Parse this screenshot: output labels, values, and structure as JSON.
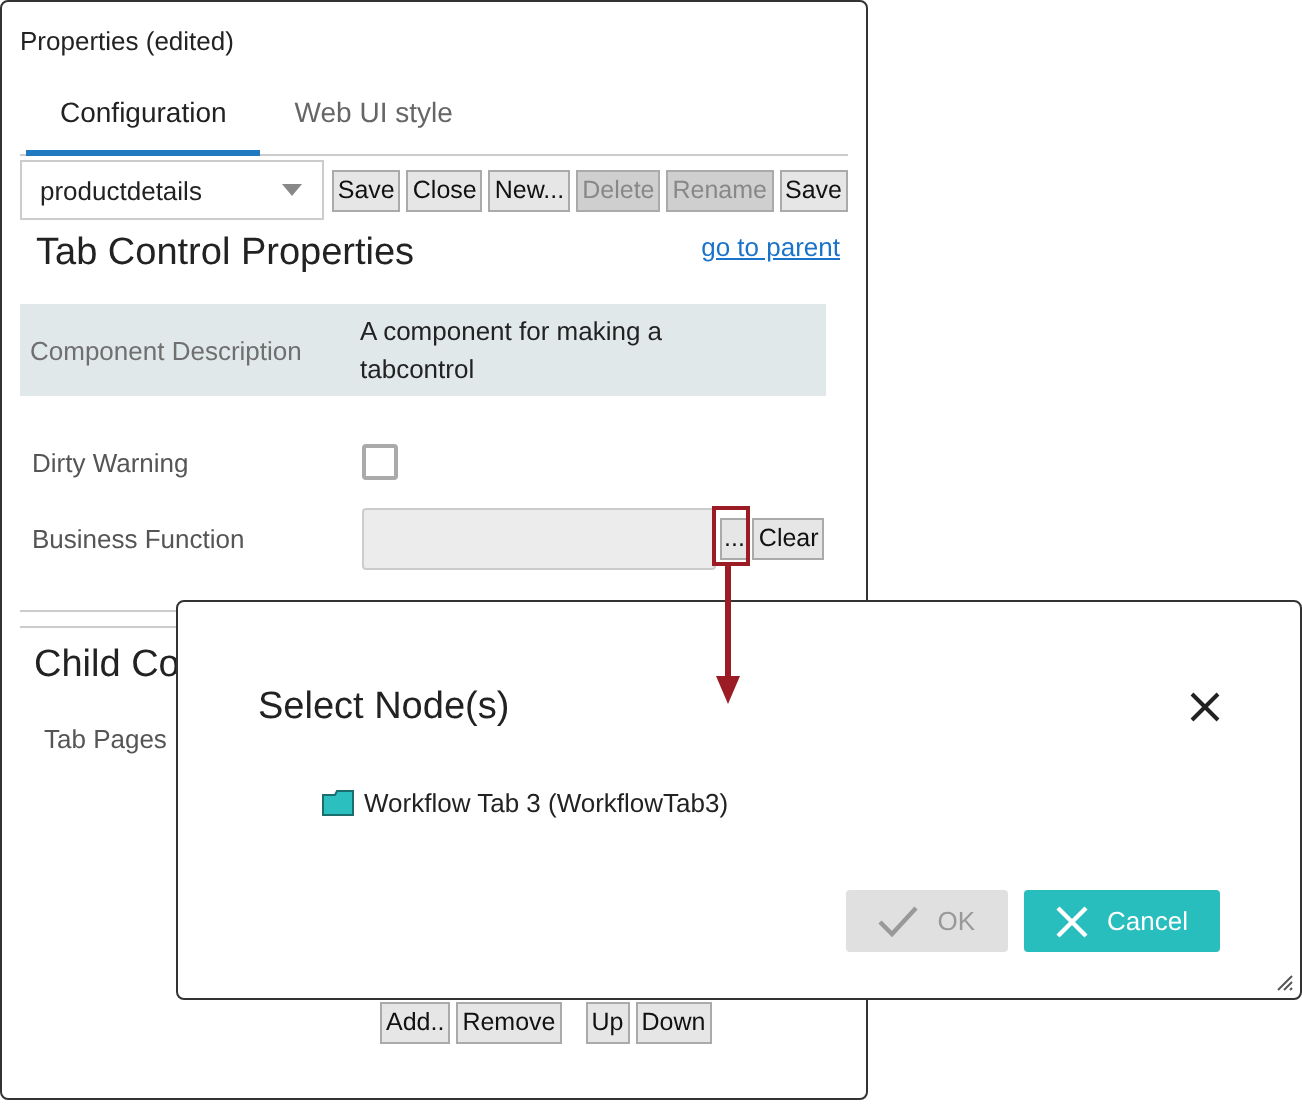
{
  "panel": {
    "title": "Properties (edited)",
    "tabs": [
      {
        "label": "Configuration",
        "selected": true
      },
      {
        "label": "Web UI style",
        "selected": false
      }
    ],
    "toolbar": {
      "select": {
        "value": "productdetails"
      },
      "buttons": [
        {
          "label": "Save",
          "disabled": false
        },
        {
          "label": "Close",
          "disabled": false
        },
        {
          "label": "New...",
          "disabled": false
        },
        {
          "label": "Delete",
          "disabled": true
        },
        {
          "label": "Rename",
          "disabled": true
        },
        {
          "label": "Save",
          "disabled": false
        }
      ]
    },
    "heading": "Tab Control Properties",
    "parent_link": "go to parent",
    "description": {
      "label": "Component Description",
      "value": "A component for making a tabcontrol"
    },
    "dirty_warning": {
      "label": "Dirty Warning",
      "checked": false
    },
    "business_function": {
      "label": "Business Function",
      "browse": "...",
      "clear": "Clear"
    },
    "child_heading": "Child Co",
    "tab_pages_label": "Tab Pages",
    "list_buttons": [
      [
        "Add..",
        "Remove"
      ],
      [
        "Up",
        "Down"
      ]
    ]
  },
  "dialog": {
    "title": "Select Node(s)",
    "nodes": [
      {
        "label": "Workflow Tab 3 (WorkflowTab3)"
      }
    ],
    "buttons": [
      {
        "label": "OK",
        "kind": "ok",
        "disabled": true
      },
      {
        "label": "Cancel",
        "kind": "cancel",
        "disabled": false
      }
    ]
  }
}
